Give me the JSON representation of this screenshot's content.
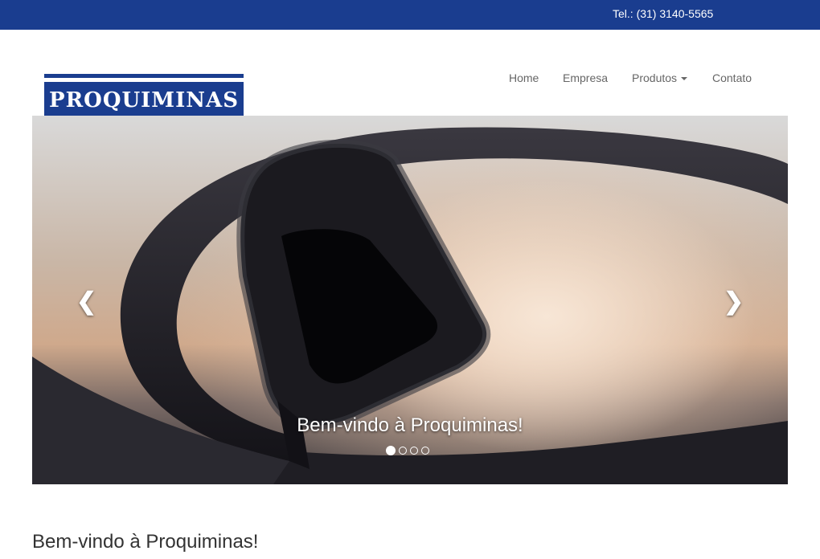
{
  "topbar": {
    "phone": "Tel.: (31) 3140-5565",
    "color": "#1a3d8f"
  },
  "logo": {
    "text": "PROQUIMINAS"
  },
  "nav": {
    "items": [
      {
        "label": "Home"
      },
      {
        "label": "Empresa"
      },
      {
        "label": "Produtos",
        "has_dropdown": true
      },
      {
        "label": "Contato"
      }
    ]
  },
  "carousel": {
    "caption": "Bem-vindo à Proquiminas!",
    "prev_icon": "chevron-left-icon",
    "next_icon": "chevron-right-icon",
    "slide_count": 4,
    "active_slide": 1
  },
  "main": {
    "heading": "Bem-vindo à Proquiminas!"
  }
}
